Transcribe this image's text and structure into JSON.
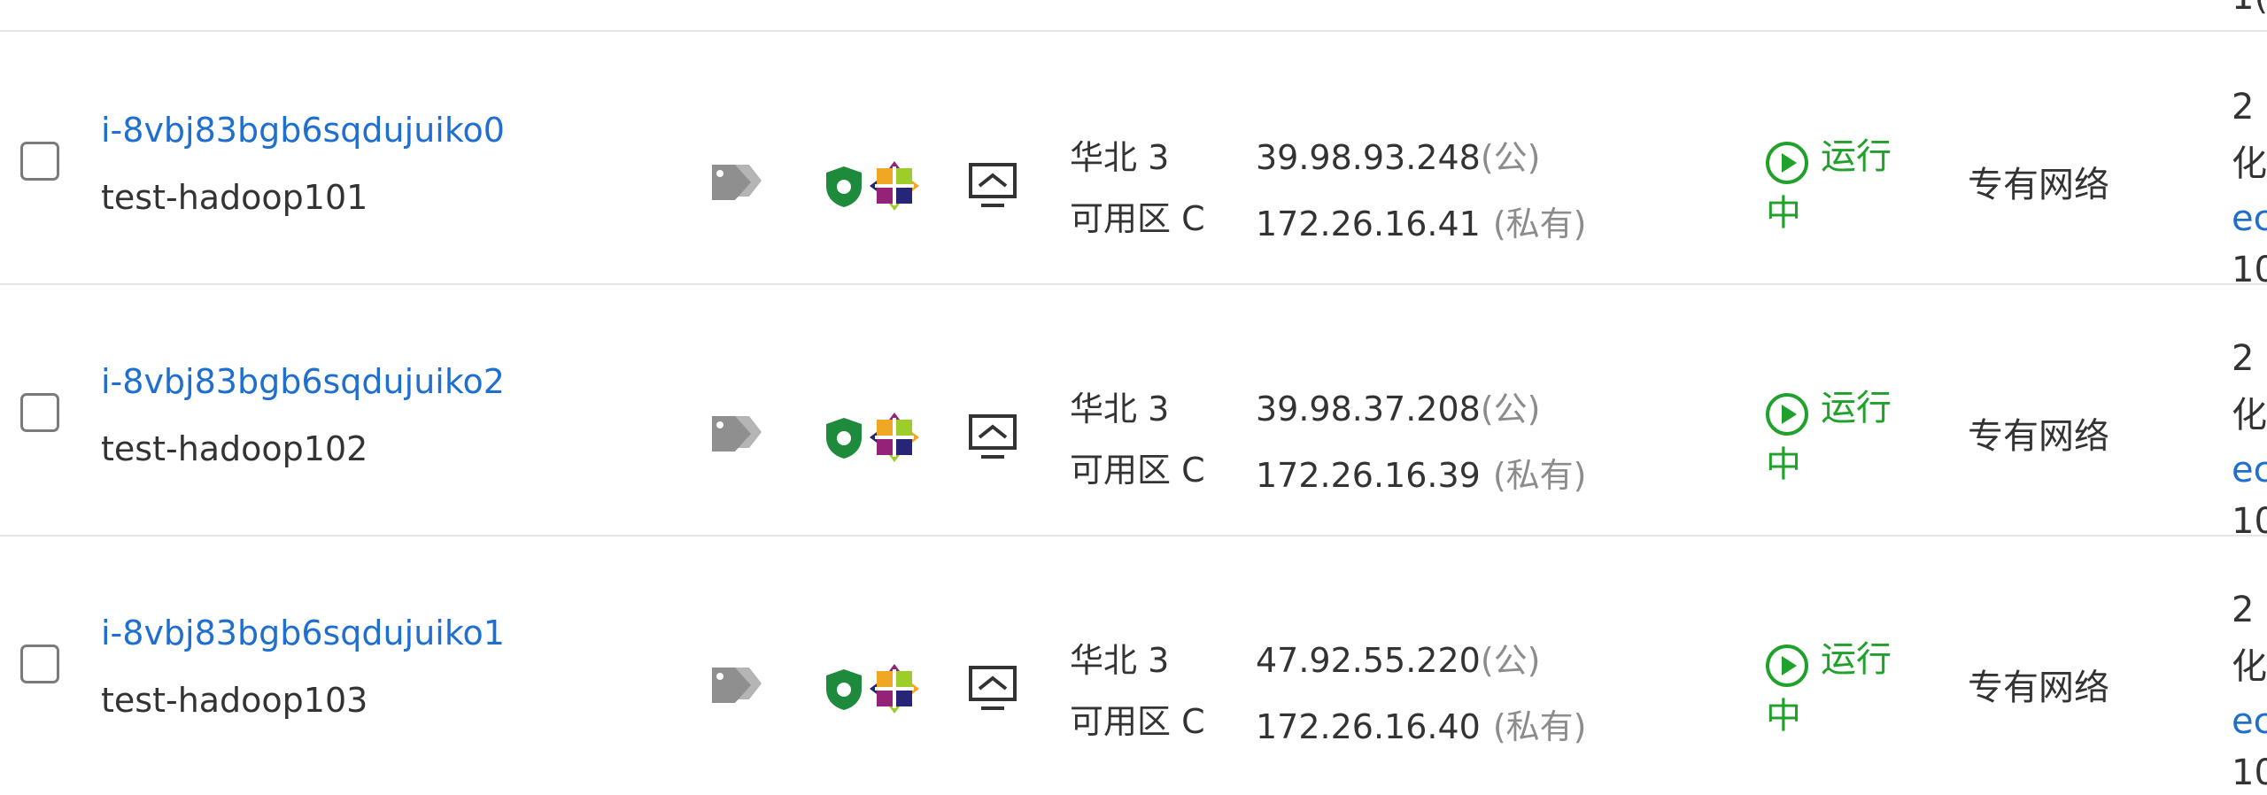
{
  "instances": [
    {
      "id": "i-8vbj83bgb6sqdujuiko0",
      "name": "test-hadoop101",
      "zone_line1": "华北 3",
      "zone_line2": "可用区 C",
      "public_ip": "39.98.93.248",
      "public_suffix": "(公)",
      "private_ip": "172.26.16.41",
      "private_suffix": "(私有)",
      "status_line1": "运行",
      "status_line2": "中",
      "network": "专有网络",
      "spec_line1": "2",
      "spec_line2": "化",
      "spec_line3": "ec",
      "spec_line4": "10"
    },
    {
      "id": "i-8vbj83bgb6sqdujuiko2",
      "name": "test-hadoop102",
      "zone_line1": "华北 3",
      "zone_line2": "可用区 C",
      "public_ip": "39.98.37.208",
      "public_suffix": "(公)",
      "private_ip": "172.26.16.39",
      "private_suffix": "(私有)",
      "status_line1": "运行",
      "status_line2": "中",
      "network": "专有网络",
      "spec_line1": "2",
      "spec_line2": "化",
      "spec_line3": "ec",
      "spec_line4": "10"
    },
    {
      "id": "i-8vbj83bgb6sqdujuiko1",
      "name": "test-hadoop103",
      "zone_line1": "华北 3",
      "zone_line2": "可用区 C",
      "public_ip": "47.92.55.220",
      "public_suffix": "(公)",
      "private_ip": "172.26.16.40",
      "private_suffix": "(私有)",
      "status_line1": "运行",
      "status_line2": "中",
      "network": "专有网络",
      "spec_line1": "2",
      "spec_line2": "化",
      "spec_line3": "ec",
      "spec_line4": "10"
    }
  ],
  "prev_row_spec_fragment": "1(",
  "icons": {
    "tag": "tag-icon",
    "security_group": "shield-icon",
    "os": "centos-logo-icon",
    "remote_connect": "monitor-icon",
    "status": "play-circle-icon"
  },
  "colors": {
    "link": "#1f6fd0",
    "running": "#1fa12b",
    "shield": "#1e8a3c",
    "muted": "#8c8c8c",
    "row_border": "#e6e6e6"
  }
}
